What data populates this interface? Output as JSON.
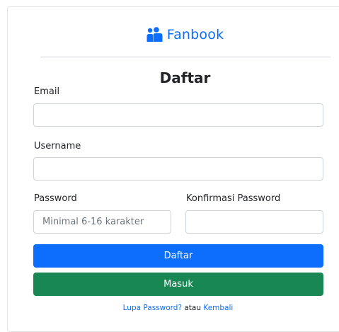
{
  "brand": {
    "name": "Fanbook",
    "icon": "people-icon",
    "color": "#0d6efd"
  },
  "form": {
    "title": "Daftar",
    "email": {
      "label": "Email",
      "value": "",
      "placeholder": ""
    },
    "username": {
      "label": "Username",
      "value": "",
      "placeholder": ""
    },
    "password": {
      "label": "Password",
      "value": "",
      "placeholder": "Minimal 6-16 karakter"
    },
    "confirm_password": {
      "label": "Konfirmasi Password",
      "value": "",
      "placeholder": ""
    }
  },
  "buttons": {
    "register_label": "Daftar",
    "register_color": "#0d6efd",
    "login_label": "Masuk",
    "login_color": "#198754"
  },
  "footer": {
    "forgot_link": "Lupa Password?",
    "separator": "atau",
    "back_link": "Kembali"
  }
}
